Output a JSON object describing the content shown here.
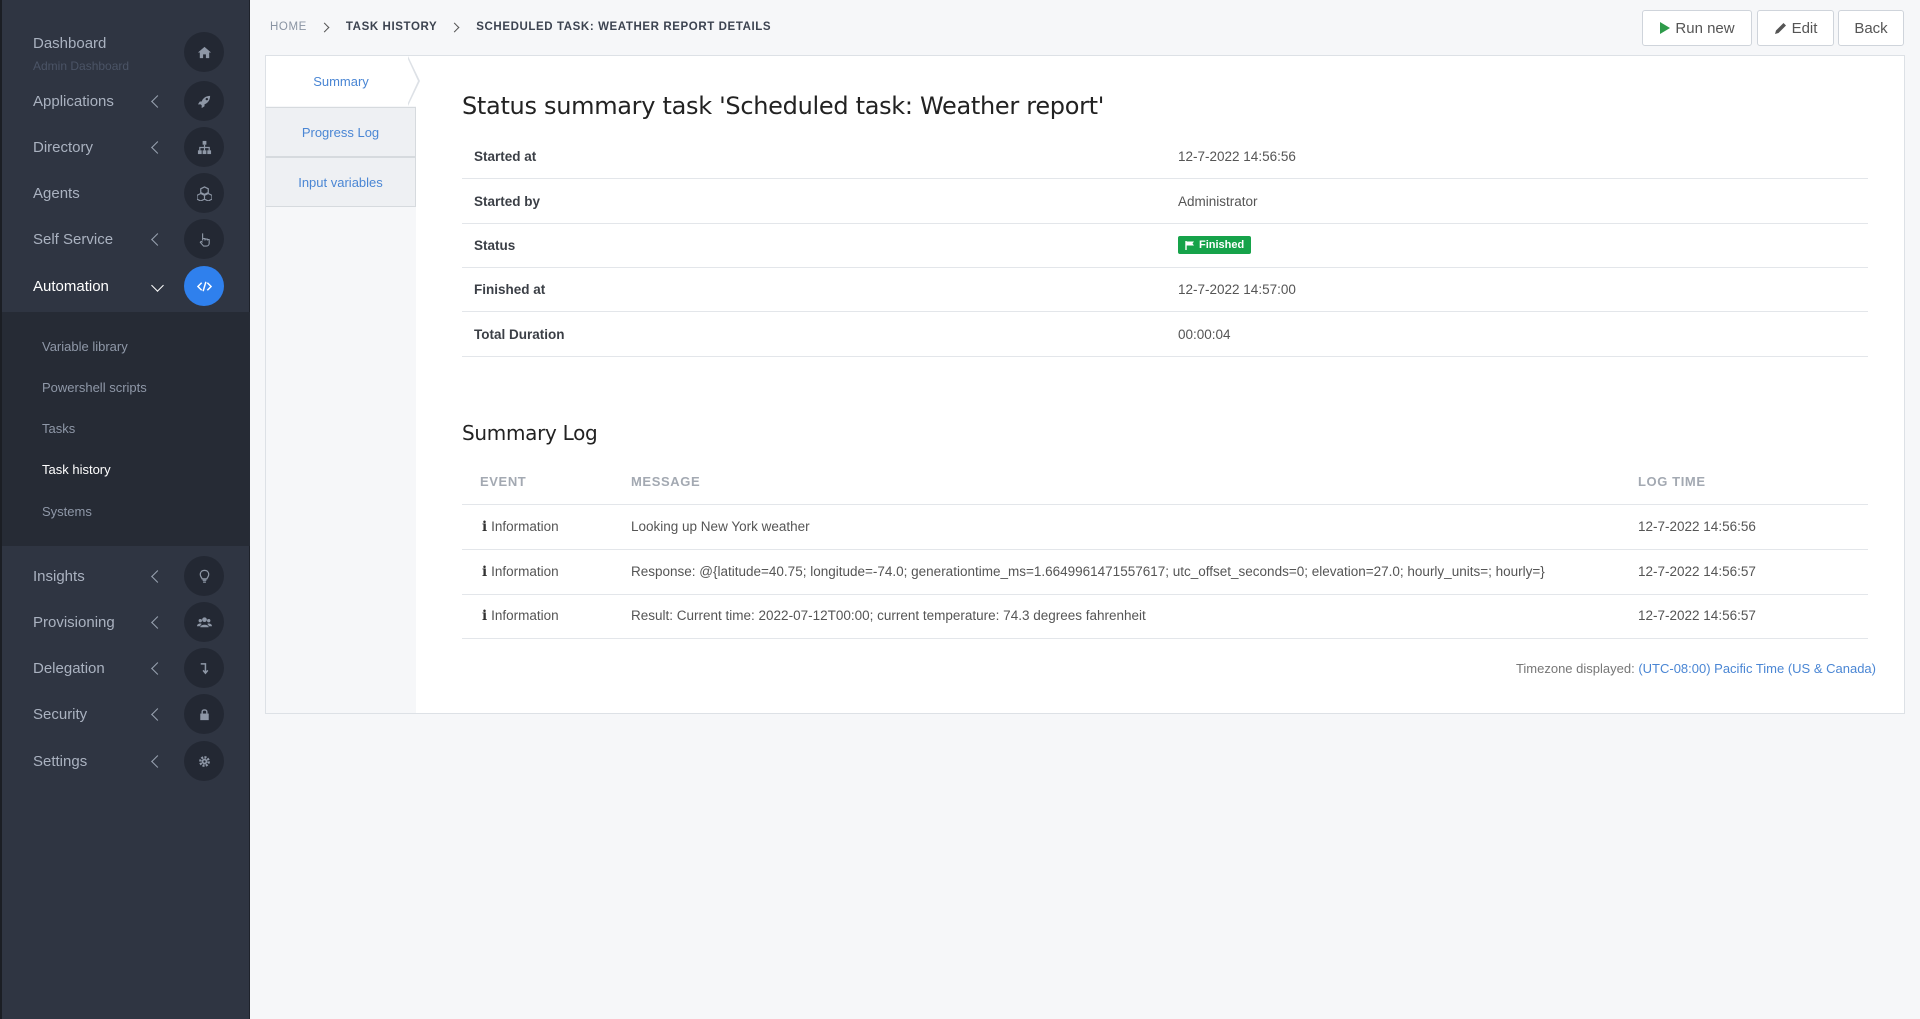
{
  "sidebar": {
    "items": [
      {
        "label": "Dashboard",
        "sub": "Admin Dashboard",
        "icon": "home-icon"
      },
      {
        "label": "Applications",
        "icon": "rocket-icon"
      },
      {
        "label": "Directory",
        "icon": "sitemap-icon"
      },
      {
        "label": "Agents",
        "icon": "cubes-icon"
      },
      {
        "label": "Self Service",
        "icon": "hand-pointer-icon"
      },
      {
        "label": "Automation",
        "icon": "code-icon"
      },
      {
        "label": "Insights",
        "icon": "lightbulb-icon"
      },
      {
        "label": "Provisioning",
        "icon": "users-icon"
      },
      {
        "label": "Delegation",
        "icon": "level-down-icon"
      },
      {
        "label": "Security",
        "icon": "lock-icon"
      },
      {
        "label": "Settings",
        "icon": "gear-icon"
      }
    ],
    "submenu": [
      "Variable library",
      "Powershell scripts",
      "Tasks",
      "Task history",
      "Systems"
    ],
    "active_sub": "Task history"
  },
  "breadcrumb": [
    "Home",
    "Task history",
    "Scheduled task: Weather report details"
  ],
  "toolbar": {
    "run_new": "Run new",
    "edit": "Edit",
    "back": "Back"
  },
  "tabs": [
    "Summary",
    "Progress Log",
    "Input variables"
  ],
  "summary": {
    "title": "Status summary task 'Scheduled task: Weather report'",
    "rows": [
      {
        "key": "Started at",
        "value": "12-7-2022 14:56:56"
      },
      {
        "key": "Started by",
        "value": "Administrator"
      },
      {
        "key": "Status",
        "value": "Finished"
      },
      {
        "key": "Finished at",
        "value": "12-7-2022 14:57:00"
      },
      {
        "key": "Total Duration",
        "value": "00:00:04"
      }
    ]
  },
  "log": {
    "title": "Summary Log",
    "headers": [
      "Event",
      "Message",
      "Log time"
    ],
    "rows": [
      {
        "event": "Information",
        "message": "Looking up New York weather",
        "time": "12-7-2022 14:56:56"
      },
      {
        "event": "Information",
        "message": "Response: @{latitude=40.75; longitude=-74.0; generationtime_ms=1.6649961471557617; utc_offset_seconds=0; elevation=27.0; hourly_units=; hourly=}",
        "time": "12-7-2022 14:56:57"
      },
      {
        "event": "Information",
        "message": "Result: Current time: 2022-07-12T00:00; current temperature: 74.3 degrees fahrenheit",
        "time": "12-7-2022 14:56:57"
      }
    ]
  },
  "timezone": {
    "label": "Timezone displayed:",
    "value": "(UTC-08:00) Pacific Time (US & Canada)"
  },
  "colors": {
    "accent": "#2f80ed",
    "success": "#16a34a",
    "sidebar": "#2f3542",
    "link": "#4a86d4"
  }
}
